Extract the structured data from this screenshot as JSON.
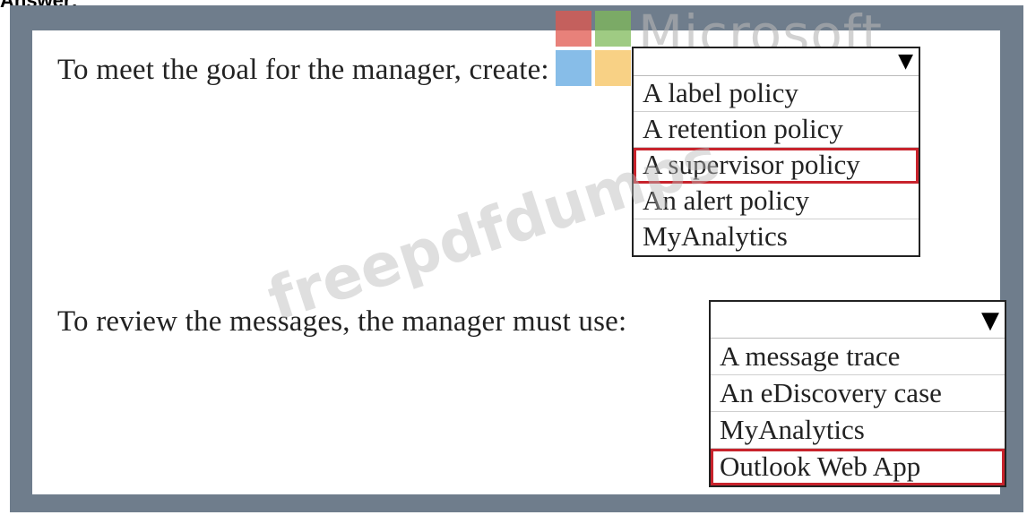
{
  "header": {
    "answer_label": "Answer:"
  },
  "watermarks": {
    "microsoft": "Microsoft",
    "site": "freepdfdumps"
  },
  "question1": {
    "prompt": "To meet the goal for the manager, create:",
    "options": [
      "A label policy",
      "A retention policy",
      "A supervisor policy",
      "An alert policy",
      "MyAnalytics"
    ],
    "selected": "A supervisor policy"
  },
  "question2": {
    "prompt": "To review the messages, the manager must use:",
    "options": [
      "A message trace",
      "An eDiscovery case",
      "MyAnalytics",
      "Outlook Web App"
    ],
    "selected": "Outlook Web App"
  },
  "icons": {
    "dropdown_arrow": "chevron-down-icon"
  },
  "colors": {
    "frame": "#6f7d8c",
    "selection_outline": "#c8232c"
  }
}
